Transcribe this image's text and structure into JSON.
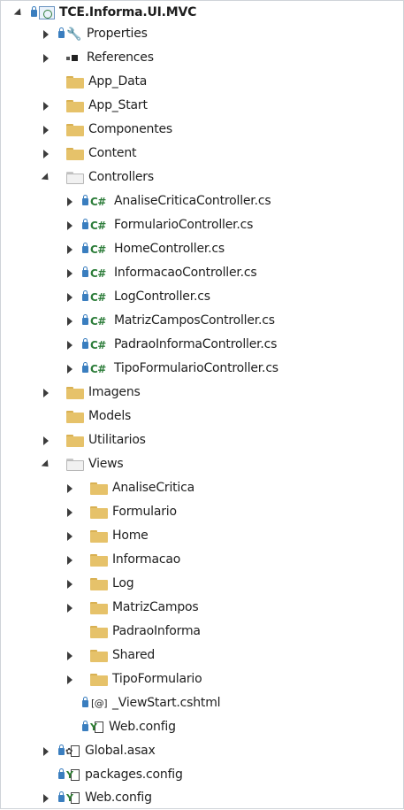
{
  "tree": {
    "project": "TCE.Informa.UI.MVC",
    "properties": "Properties",
    "references": "References",
    "app_data": "App_Data",
    "app_start": "App_Start",
    "componentes": "Componentes",
    "content": "Content",
    "controllers": {
      "label": "Controllers",
      "items": [
        "AnaliseCriticaController.cs",
        "FormularioController.cs",
        "HomeController.cs",
        "InformacaoController.cs",
        "LogController.cs",
        "MatrizCamposController.cs",
        "PadraoInformaController.cs",
        "TipoFormularioController.cs"
      ]
    },
    "imagens": "Imagens",
    "models": "Models",
    "utilitarios": "Utilitarios",
    "views": {
      "label": "Views",
      "items": [
        "AnaliseCritica",
        "Formulario",
        "Home",
        "Informacao",
        "Log",
        "MatrizCampos",
        "PadraoInforma",
        "Shared",
        "TipoFormulario",
        "_ViewStart.cshtml",
        "Web.config"
      ]
    },
    "global_asax": "Global.asax",
    "packages_config": "packages.config",
    "web_config": "Web.config"
  },
  "icons": {
    "csharp_glyph": "C#",
    "cshtml_glyph": "[@]"
  },
  "colors": {
    "folder": "#e6c26a",
    "csharp": "#2d7d3a",
    "lock": "#3a7ebf"
  }
}
